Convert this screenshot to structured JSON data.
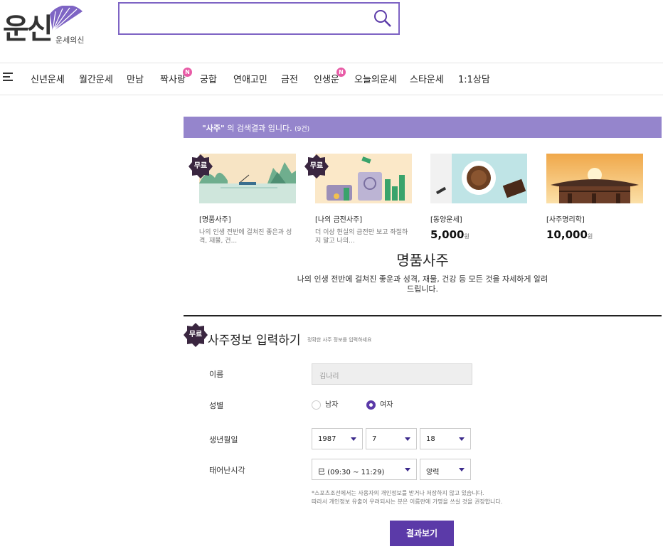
{
  "header": {
    "logo_text": "운신",
    "logo_subtext": "운세의신",
    "search": {
      "value": "",
      "placeholder": ""
    }
  },
  "nav": {
    "items": [
      {
        "label": "신년운세",
        "badge": ""
      },
      {
        "label": "월간운세",
        "badge": ""
      },
      {
        "label": "만남",
        "badge": ""
      },
      {
        "label": "짝사랑",
        "badge": "N"
      },
      {
        "label": "궁합",
        "badge": ""
      },
      {
        "label": "연애고민",
        "badge": ""
      },
      {
        "label": "금전",
        "badge": ""
      },
      {
        "label": "인생운",
        "badge": "N"
      },
      {
        "label": "오늘의운세",
        "badge": ""
      },
      {
        "label": "스타운세",
        "badge": ""
      },
      {
        "label": "1:1상담",
        "badge": ""
      }
    ]
  },
  "search_result": {
    "keyword": "\"사주\"",
    "text": " 의 검색결과 입니다.",
    "count": "(9건)"
  },
  "products": [
    {
      "badge": "무료",
      "title": "[명품사주]",
      "desc": "나의 인생 전반에 걸쳐진 좋은과 성격, 재물, 건...",
      "price": "",
      "currency": ""
    },
    {
      "badge": "무료",
      "title": "[나의 금전사주]",
      "desc": "더 이상 현실의 금전만 보고 좌절하지 말고 나의...",
      "price": "",
      "currency": ""
    },
    {
      "badge": "",
      "title": "[동양운세]",
      "desc": "",
      "price": "5,000",
      "currency": "원"
    },
    {
      "badge": "",
      "title": "[사주명리학]",
      "desc": "",
      "price": "10,000",
      "currency": "원"
    }
  ],
  "product_detail": {
    "title": "명품사주",
    "desc": "나의 인생 전반에 걸쳐진 좋운과 성격, 재물, 건강 등 모든 것을 자세하게 알려드립니다."
  },
  "form": {
    "badge": "무료",
    "title": "사주정보 입력하기",
    "note": "정확한 사주 정보를 입력하세요",
    "name": {
      "label": "이름",
      "value": "김나리"
    },
    "gender": {
      "label": "성별",
      "options": [
        "남자",
        "여자"
      ],
      "selected": "여자"
    },
    "birth": {
      "label": "생년월일",
      "year": "1987",
      "month": "7",
      "day": "18"
    },
    "time": {
      "label": "태어난시각",
      "hour": "巳 (09:30 ~ 11:29)",
      "calendar": "양력"
    },
    "privacy_line1": "*스포츠조선에서는 사용자의 개인정보를 받거나 저장하지 않고 있습니다.",
    "privacy_line2": "따라서 개인정보 유출이 우려되시는 분은 이름란에 가명을 쓰실 것을 권장합니다.",
    "submit": "결과보기"
  },
  "colors": {
    "accent": "#5b3aa8",
    "result_bar": "#9585cc",
    "badge_dark": "#3a2640",
    "new_badge": "#e85ba6"
  }
}
